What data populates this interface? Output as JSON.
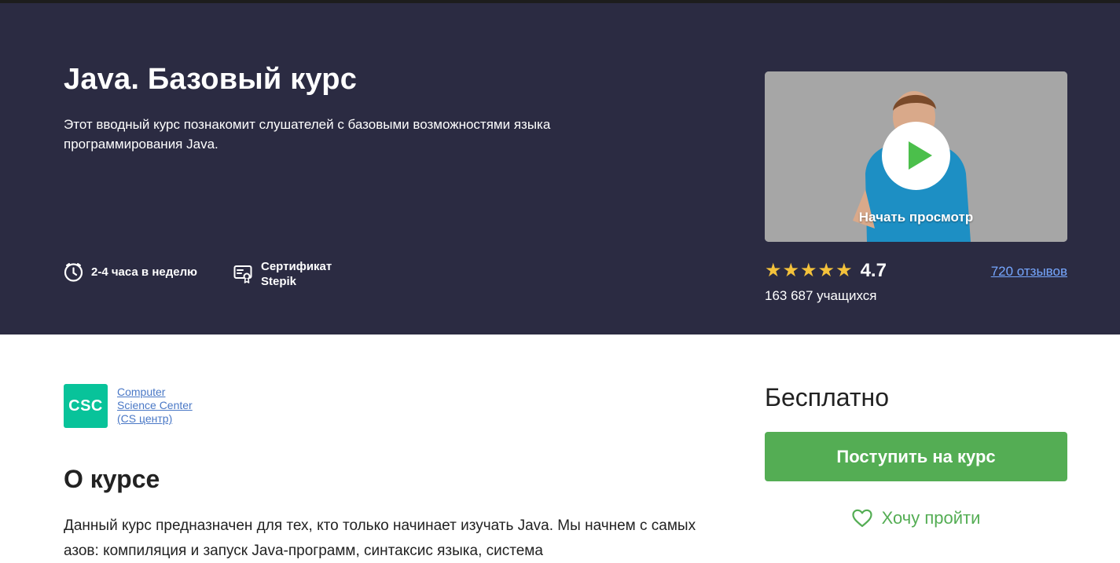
{
  "course": {
    "title": "Java. Базовый курс",
    "subtitle": "Этот вводный курс познакомит слушателей с базовыми возможностями языка программирования Java."
  },
  "meta": {
    "workload": "2-4 часа в неделю",
    "certificate_line1": "Сертификат",
    "certificate_line2": "Stepik",
    "workload_icon": "clock-icon",
    "certificate_icon": "certificate-icon"
  },
  "video": {
    "label": "Начать просмотр",
    "play_icon": "play-icon"
  },
  "rating": {
    "stars": 5,
    "value": "4.7",
    "reviews": "720 отзывов",
    "learners": "163 687 учащихся"
  },
  "organization": {
    "logo_text": "CSC",
    "name_line1": "Computer",
    "name_line2": "Science Center",
    "name_line3": "(CS центр)"
  },
  "about": {
    "heading": "О курсе",
    "text": "Данный курс предназначен для тех, кто только начинает изучать Java. Мы начнем с самых азов: компиляция и запуск Java-программ, синтаксис языка, система"
  },
  "sidebar": {
    "price": "Бесплатно",
    "enroll_label": "Поступить на курс",
    "wish_label": "Хочу пройти",
    "wish_icon": "heart-icon"
  },
  "colors": {
    "hero_bg": "#2b2b42",
    "accent_green": "#54ad54",
    "star": "#f4c23b",
    "link": "#76a7ff",
    "logo_bg": "#08c39a"
  }
}
